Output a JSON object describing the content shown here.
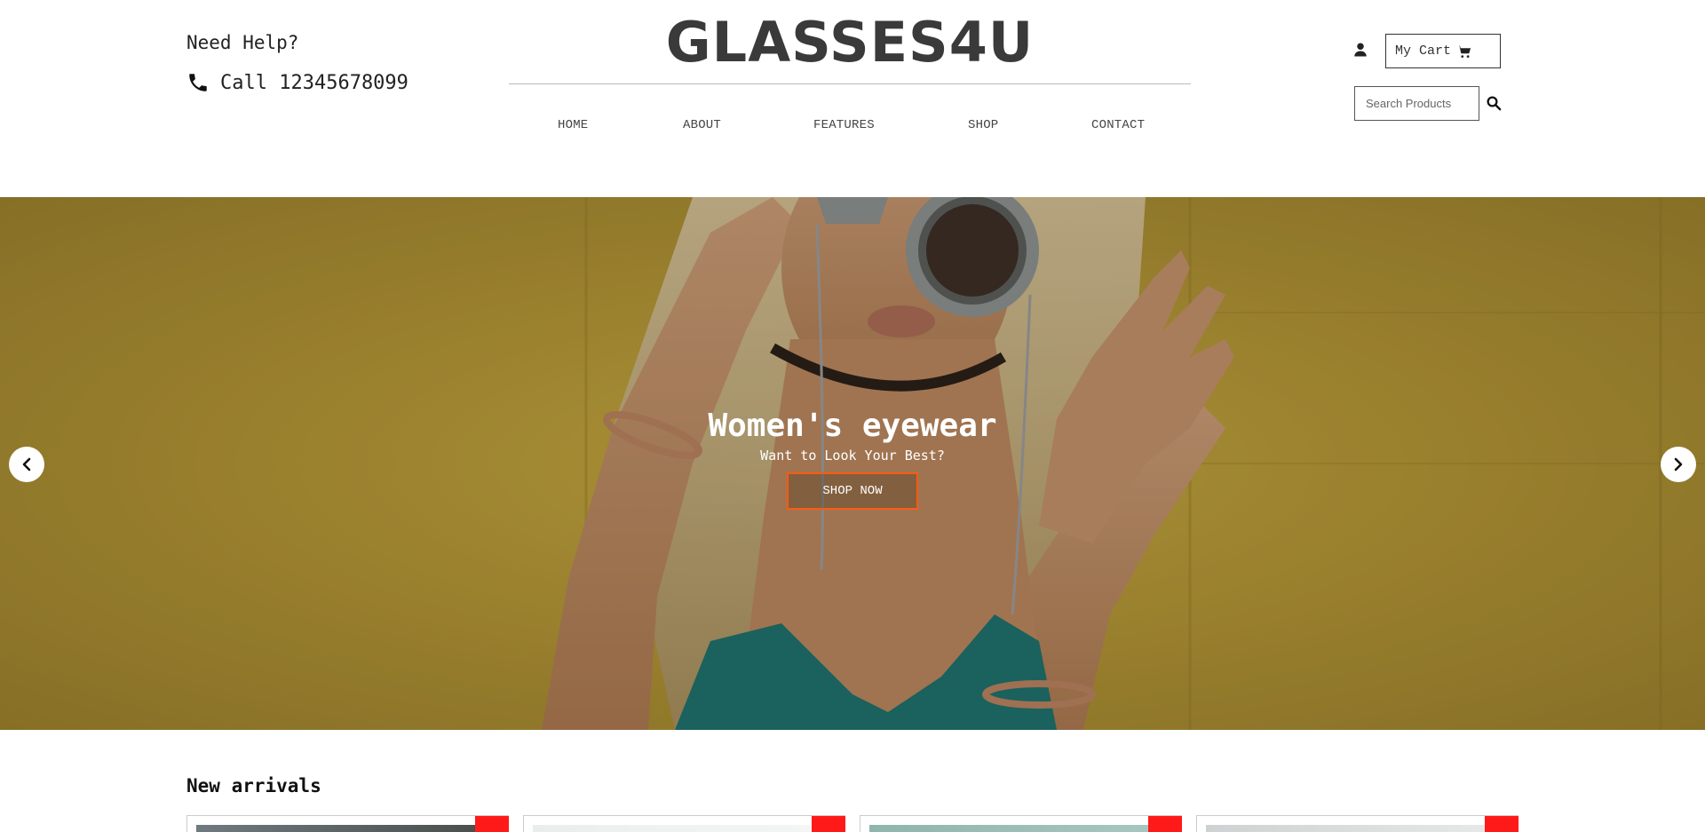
{
  "header": {
    "help_title": "Need Help?",
    "call_text": "Call 12345678099",
    "logo": "GLASSES4U",
    "nav": [
      "HOME",
      "ABOUT",
      "FEATURES",
      "SHOP",
      "CONTACT"
    ],
    "cart_label": "My Cart",
    "search_placeholder": "Search Products"
  },
  "hero": {
    "title": "Women's eyewear",
    "subtitle": "Want to Look Your Best?",
    "button": "SHOP NOW"
  },
  "new_arrivals": {
    "title": "New arrivals",
    "card_count": 4
  },
  "colors": {
    "accent": "#ff5a12",
    "badge": "#ff1a1a",
    "logo": "#3a3a3a",
    "hero_background": "#b39737"
  },
  "icons": {
    "phone": "phone-icon",
    "user": "user-icon",
    "cart": "cart-icon",
    "search": "search-icon",
    "prev": "chevron-left-icon",
    "next": "chevron-right-icon"
  }
}
